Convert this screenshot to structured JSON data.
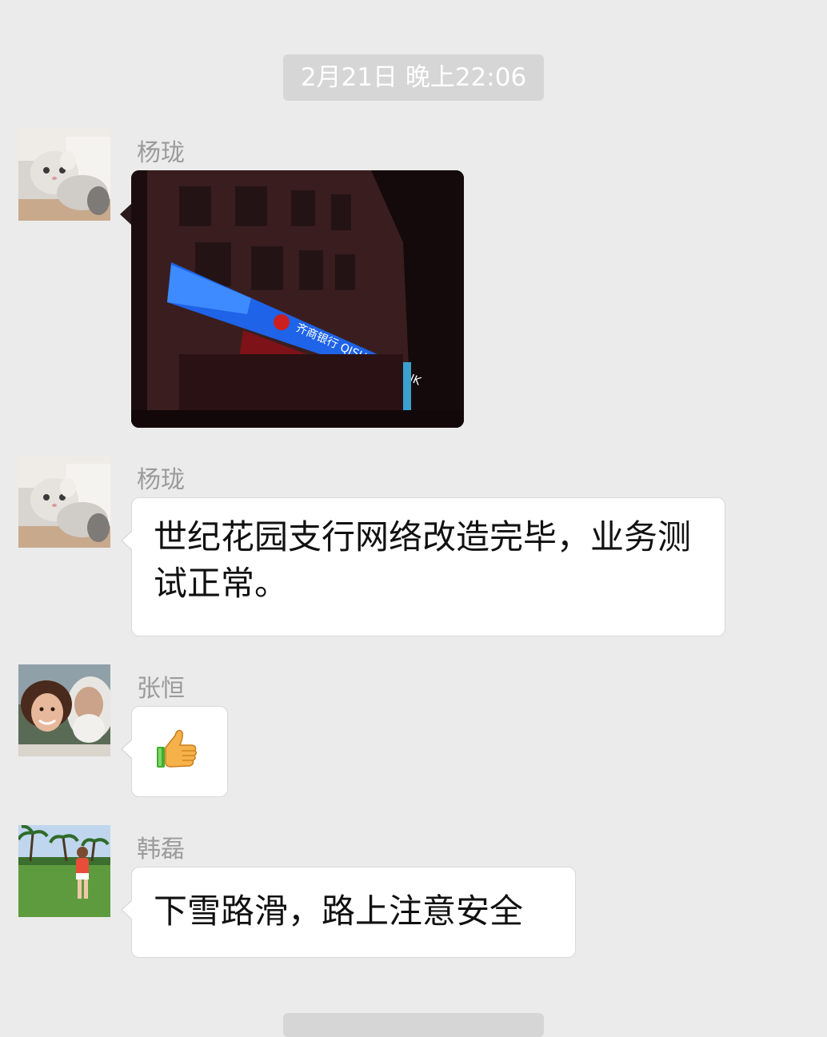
{
  "chat": {
    "timestamp": "2月21日 晚上22:06",
    "messages": [
      {
        "sender": "杨珑",
        "avatar_icon": "kitten-avatar",
        "type": "image",
        "image_icon": "bank-building-photo",
        "sign_text": "齐商银行 QISHANG BANK"
      },
      {
        "sender": "杨珑",
        "avatar_icon": "kitten-avatar",
        "type": "text",
        "text": "世纪花园支行网络改造完毕，业务测试正常。"
      },
      {
        "sender": "张恒",
        "avatar_icon": "couple-avatar",
        "type": "emoji",
        "emoji_icon": "thumbs-up-icon"
      },
      {
        "sender": "韩磊",
        "avatar_icon": "child-beach-avatar",
        "type": "text",
        "text": "下雪路滑，路上注意安全"
      }
    ]
  }
}
